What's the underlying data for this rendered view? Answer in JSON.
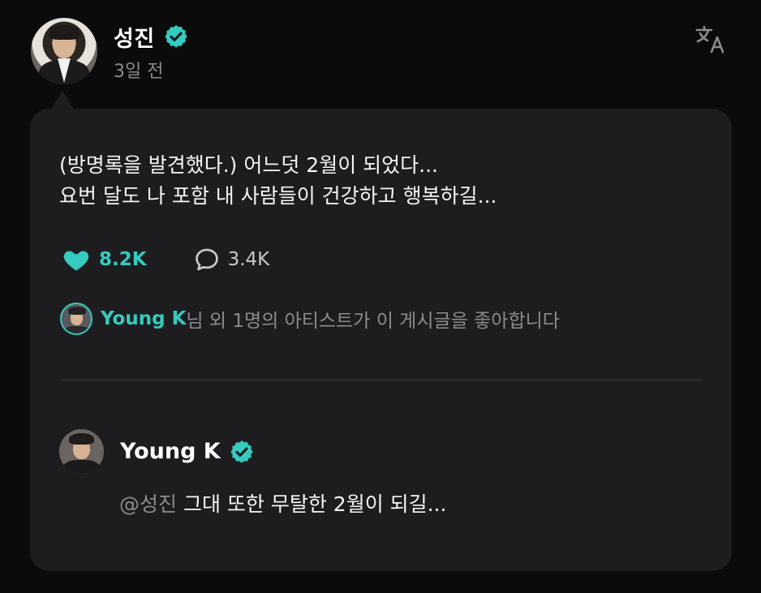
{
  "post": {
    "author_name": "성진",
    "time_ago": "3일 전",
    "body": "(방명록을 발견했다.) 어느덧 2월이 되었다...\n요번 달도 나 포함 내 사람들이 건강하고 행복하길...",
    "likes": "8.2K",
    "comments": "3.4K",
    "liked_by_name": "Young K",
    "liked_by_rest": "님 외 1명의 아티스트가 이 게시글을 좋아합니다"
  },
  "reply": {
    "author_name": "Young K",
    "mention": "@성진",
    "text": " 그대 또한 무탈한 2월이 되길..."
  },
  "colors": {
    "accent": "#35cbbf",
    "background": "#0b0b0c",
    "card": "#1d1d1f",
    "muted_text": "#8b8b8f"
  },
  "icons": [
    "verified-badge-icon",
    "translate-icon",
    "heart-icon",
    "comment-icon"
  ]
}
